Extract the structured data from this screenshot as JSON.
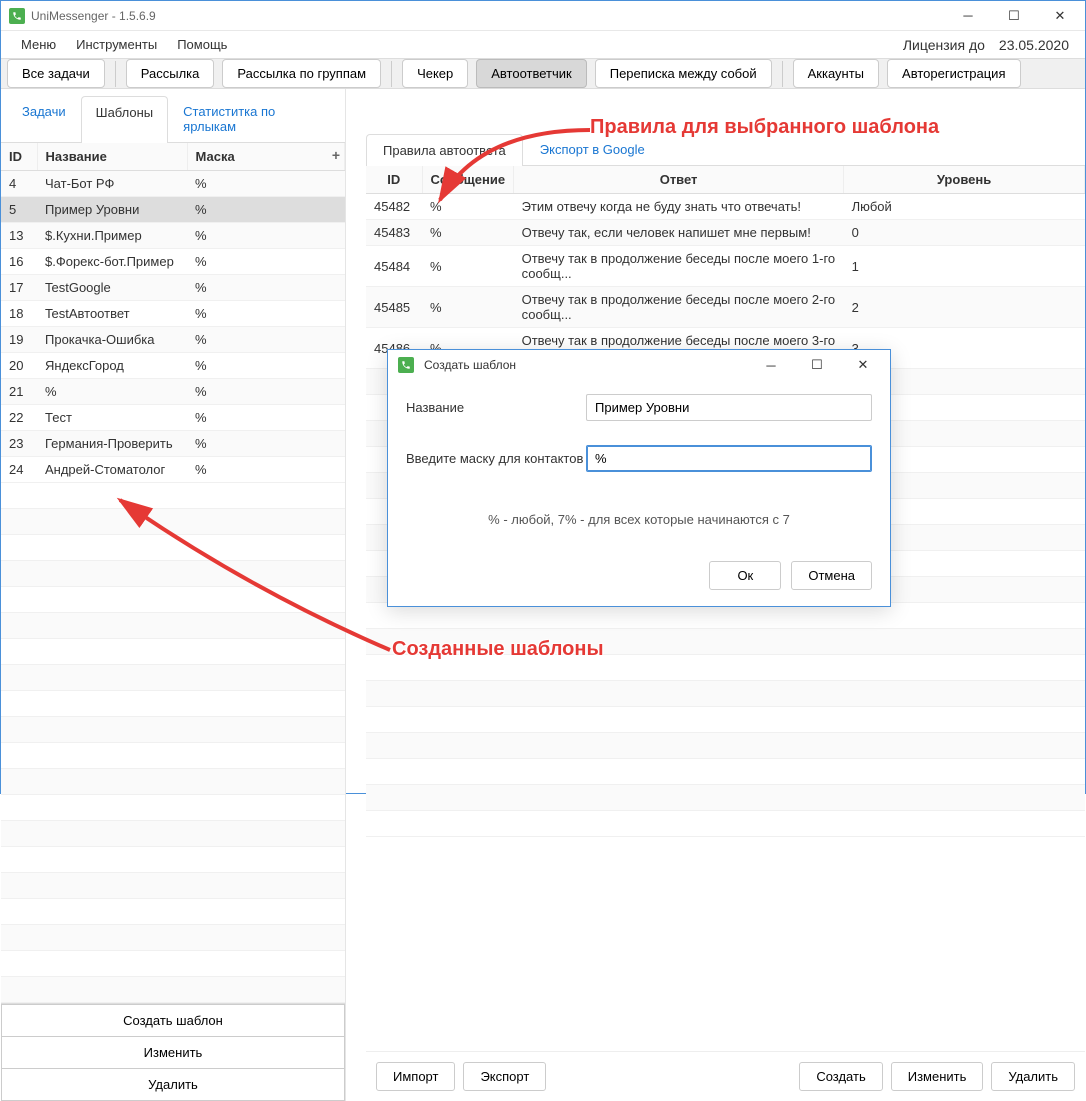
{
  "titlebar": {
    "title": "UniMessenger - 1.5.6.9"
  },
  "menu": {
    "items": [
      "Меню",
      "Инструменты",
      "Помощь"
    ]
  },
  "license": {
    "label": "Лицензия до",
    "date": "23.05.2020"
  },
  "toolbar": {
    "all_tasks": "Все задачи",
    "mailing": "Рассылка",
    "group_mailing": "Рассылка по группам",
    "checker": "Чекер",
    "autoresponder": "Автоответчик",
    "chat_between": "Переписка между собой",
    "accounts": "Аккаунты",
    "autoreg": "Авторегистрация"
  },
  "left": {
    "tabs": {
      "tasks": "Задачи",
      "templates": "Шаблоны",
      "stats": "Статиститка по ярлыкам"
    },
    "headers": {
      "id": "ID",
      "name": "Название",
      "mask": "Маска"
    },
    "rows": [
      {
        "id": "4",
        "name": "Чат-Бот РФ",
        "mask": "%"
      },
      {
        "id": "5",
        "name": "Пример Уровни",
        "mask": "%"
      },
      {
        "id": "13",
        "name": "$.Кухни.Пример",
        "mask": "%"
      },
      {
        "id": "16",
        "name": "$.Форекс-бот.Пример",
        "mask": "%"
      },
      {
        "id": "17",
        "name": "TestGoogle",
        "mask": "%"
      },
      {
        "id": "18",
        "name": "TestАвтоответ",
        "mask": "%"
      },
      {
        "id": "19",
        "name": "Прокачка-Ошибка",
        "mask": "%"
      },
      {
        "id": "20",
        "name": "ЯндексГород",
        "mask": "%"
      },
      {
        "id": "21",
        "name": "%",
        "mask": "%"
      },
      {
        "id": "22",
        "name": "Тест",
        "mask": "%"
      },
      {
        "id": "23",
        "name": "Германия-Проверить",
        "mask": "%"
      },
      {
        "id": "24",
        "name": "Андрей-Стоматолог",
        "mask": "%"
      }
    ],
    "actions": {
      "create": "Создать шаблон",
      "edit": "Изменить",
      "delete": "Удалить"
    }
  },
  "right": {
    "tabs": {
      "rules": "Правила автоответа",
      "export": "Экспорт в Google"
    },
    "headers": {
      "id": "ID",
      "message": "Сообщение",
      "answer": "Ответ",
      "level": "Уровень"
    },
    "rows": [
      {
        "id": "45482",
        "msg": "%",
        "ans": "Этим отвечу когда не буду знать что отвечать!",
        "lvl": "Любой"
      },
      {
        "id": "45483",
        "msg": "%",
        "ans": "Отвечу так, если человек напишет мне первым!",
        "lvl": "0"
      },
      {
        "id": "45484",
        "msg": "%",
        "ans": "Отвечу так в продолжение беседы после моего 1-го сообщ...",
        "lvl": "1"
      },
      {
        "id": "45485",
        "msg": "%",
        "ans": "Отвечу так в продолжение беседы после моего 2-го сообщ...",
        "lvl": "2"
      },
      {
        "id": "45486",
        "msg": "%",
        "ans": "Отвечу так в продолжение беседы после моего 3-го сообщ...",
        "lvl": "3"
      }
    ],
    "actions": {
      "import": "Импорт",
      "export": "Экспорт",
      "create": "Создать",
      "edit": "Изменить",
      "delete": "Удалить"
    }
  },
  "dialog": {
    "title": "Создать шаблон",
    "name_label": "Название",
    "name_value": "Пример Уровни",
    "mask_label": "Введите маску для контактов",
    "mask_value": "%",
    "hint": "% - любой, 7% - для всех которые начинаются с 7",
    "ok": "Ок",
    "cancel": "Отмена"
  },
  "annotations": {
    "rules_for_template": "Правила для выбранного шаблона",
    "created_templates": "Созданные шаблоны"
  }
}
